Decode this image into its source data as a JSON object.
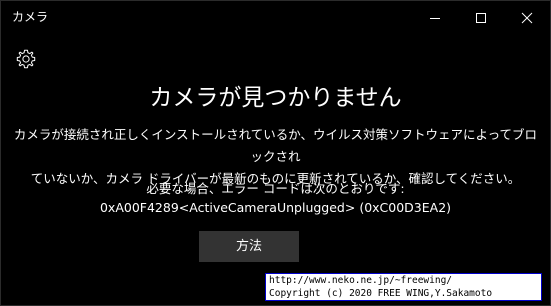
{
  "window": {
    "title": "カメラ",
    "minimize_icon": "minimize-icon",
    "maximize_icon": "maximize-icon",
    "close_icon": "close-icon"
  },
  "settings": {
    "icon": "gear-icon"
  },
  "main": {
    "heading": "カメラが見つかりません",
    "message_line1": "カメラが接続され正しくインストールされているか、ウイルス対策ソフトウェアによってブロックされ",
    "message_line2": "ていないか、カメラ ドライバーが最新のものに更新されているか、確認してください。",
    "error_label": "必要な場合、エラー コードは次のとおりです:",
    "error_code": "0xA00F4289<ActiveCameraUnplugged> (0xC00D3EA2)",
    "button_label": "方法"
  },
  "watermark": {
    "line1": "http://www.neko.ne.jp/~freewing/",
    "line2": "Copyright (c) 2020 FREE WING,Y.Sakamoto"
  },
  "colors": {
    "background": "#000000",
    "text": "#ffffff",
    "button_bg": "#333333"
  }
}
